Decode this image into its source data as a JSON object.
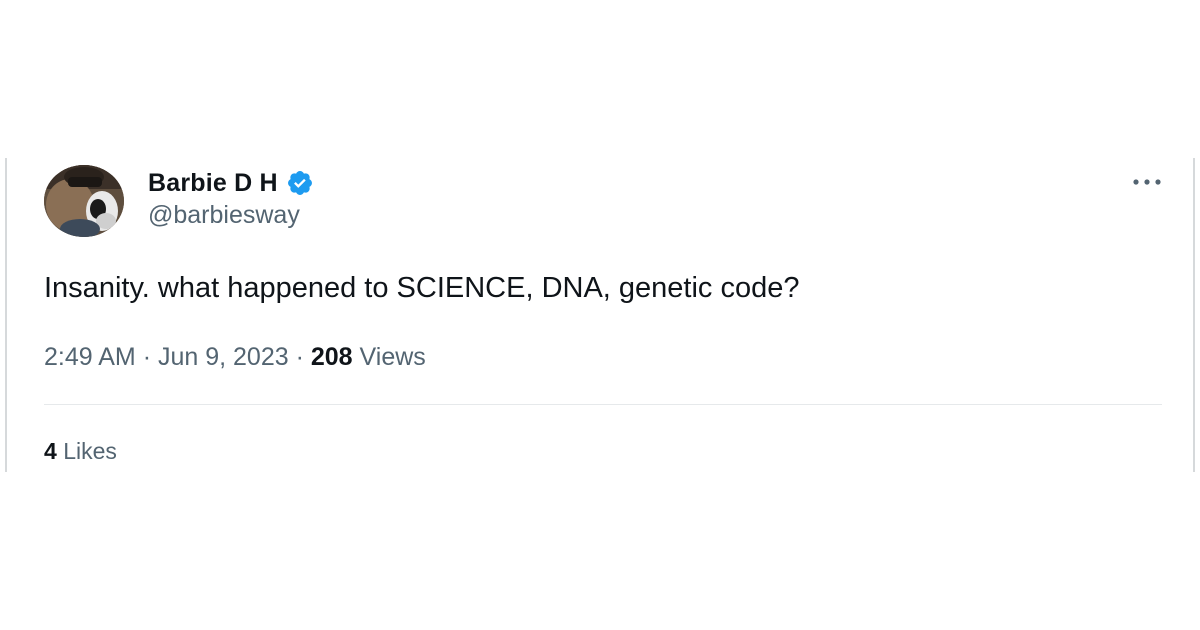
{
  "tweet": {
    "author": {
      "display_name": "Barbie D H",
      "handle": "@barbiesway",
      "verified": true,
      "verified_icon": "verified-badge-icon",
      "avatar_icon": "profile-photo"
    },
    "more_icon": "more-options-icon",
    "text": "Insanity. what happened to SCIENCE, DNA, genetic code?",
    "time": "2:49 AM",
    "separator": "·",
    "date": "Jun 9, 2023",
    "views_count": "208",
    "views_label": "Views",
    "likes_count": "4",
    "likes_label": "Likes"
  },
  "colors": {
    "text_primary": "#0f1419",
    "text_secondary": "#536471",
    "verified_blue": "#1d9bf0",
    "divider": "#e6e9eb"
  }
}
